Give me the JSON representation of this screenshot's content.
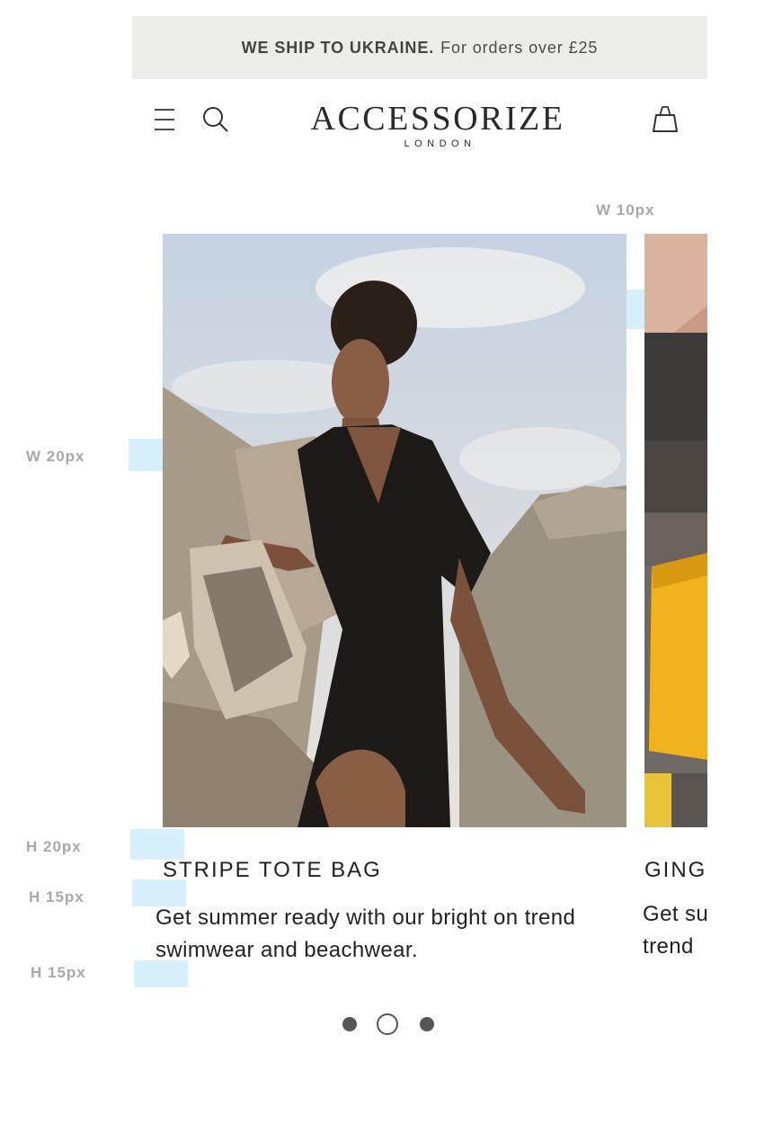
{
  "banner": {
    "bold": "WE SHIP TO UKRAINE.",
    "text": "For orders over £25"
  },
  "header": {
    "logo_main": "ACCESSORIZE",
    "logo_sub": "LONDON",
    "icons": [
      "menu-icon",
      "search-icon",
      "shopping-bag-icon"
    ]
  },
  "specs": {
    "gap_width": "W 10px",
    "side_width": "W 20px",
    "image_title_gap": "H 20px",
    "title_desc_gap": "H 15px",
    "desc_bottom_gap": "H 15px"
  },
  "cards": [
    {
      "title": "STRIPE TOTE BAG",
      "description": "Get summer ready with our bright on trend swimwear and beachwear."
    },
    {
      "title": "GINGHAM",
      "description": "Get summer ready with our bright on trend"
    }
  ],
  "carousel": {
    "total": 3,
    "active_index": 1
  },
  "colors": {
    "banner_bg": "#ececeb",
    "spec_highlight": "#d6f0fb",
    "text": "#222222",
    "dot": "#555555"
  }
}
